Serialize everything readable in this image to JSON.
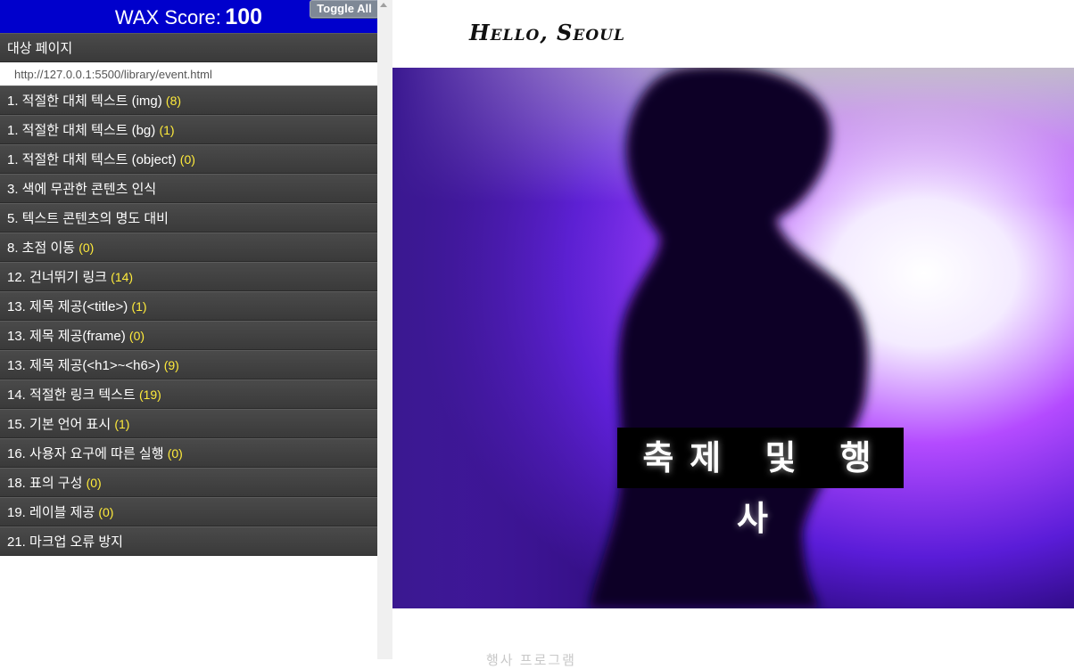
{
  "wax": {
    "score_label": "WAX Score:",
    "score_value": "100",
    "toggle_all": "Toggle All",
    "target_page_label": "대상 페이지",
    "target_url": "http://127.0.0.1:5500/library/event.html",
    "items": [
      {
        "label": "1. 적절한 대체 텍스트 (img)",
        "count": "(8)"
      },
      {
        "label": "1. 적절한 대체 텍스트 (bg)",
        "count": "(1)"
      },
      {
        "label": "1. 적절한 대체 텍스트 (object)",
        "count": "(0)"
      },
      {
        "label": "3. 색에 무관한 콘텐츠 인식",
        "count": ""
      },
      {
        "label": "5. 텍스트 콘텐츠의 명도 대비",
        "count": ""
      },
      {
        "label": "8. 초점 이동",
        "count": "(0)"
      },
      {
        "label": "12. 건너뛰기 링크",
        "count": "(14)"
      },
      {
        "label": "13. 제목 제공(<title>)",
        "count": "(1)"
      },
      {
        "label": "13. 제목 제공(frame)",
        "count": "(0)"
      },
      {
        "label": "13. 제목 제공(<h1>~<h6>)",
        "count": "(9)"
      },
      {
        "label": "14. 적절한 링크 텍스트",
        "count": "(19)"
      },
      {
        "label": "15. 기본 언어 표시",
        "count": "(1)"
      },
      {
        "label": "16. 사용자 요구에 따른 실행",
        "count": "(0)"
      },
      {
        "label": "18. 표의 구성",
        "count": "(0)"
      },
      {
        "label": "19. 레이블 제공",
        "count": "(0)"
      },
      {
        "label": "21. 마크업 오류 방지",
        "count": ""
      }
    ]
  },
  "site": {
    "logo": "Hello, Seoul",
    "hero_title": "축제 및 행사",
    "below_text": "행사 프로그램"
  },
  "colors": {
    "wax_header": "#0000cc",
    "row_bg": "#3f3f3f",
    "count_text": "#ffeb3b"
  }
}
